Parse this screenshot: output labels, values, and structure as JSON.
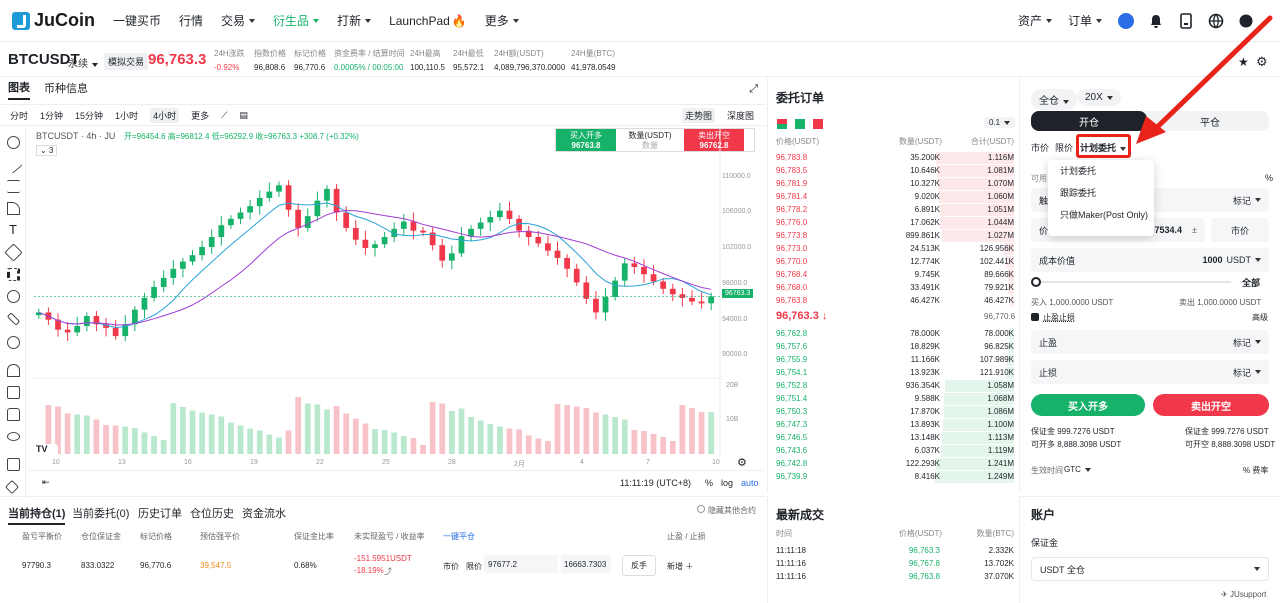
{
  "nav": {
    "logo": "JuCoin",
    "items": [
      "一键买币",
      "行情",
      "交易",
      "衍生品",
      "打新",
      "LaunchPad",
      "更多"
    ],
    "right": [
      "资产",
      "订单"
    ]
  },
  "ticker": {
    "symbol": "BTCUSDT",
    "perp": "永续",
    "tag": "模拟交易",
    "price": "96,763.3",
    "stats": [
      {
        "label": "24H涨跌",
        "value": "-0.92%",
        "color": "#f0384a"
      },
      {
        "label": "指数价格",
        "value": "96,808.6"
      },
      {
        "label": "标记价格",
        "value": "96,770.6"
      },
      {
        "label": "资金费率 / 结算时间",
        "value": "0.0005% / 00:05:00",
        "color": "#17b26a"
      },
      {
        "label": "24H最高",
        "value": "100,110.5"
      },
      {
        "label": "24H最低",
        "value": "95,572.1"
      },
      {
        "label": "24H额(USDT)",
        "value": "4,089,796,370.0000"
      },
      {
        "label": "24H量(BTC)",
        "value": "41,978.0549"
      }
    ]
  },
  "chartpanel": {
    "tabs": [
      "图表",
      "币种信息"
    ],
    "timeframes": [
      "分时",
      "1分钟",
      "15分钟",
      "1小时",
      "4小时",
      "更多"
    ],
    "views": [
      "走势图",
      "深度图"
    ],
    "legend": "BTCUSDT · 4h · JU",
    "ohlc": "开=96454.6 高=96812.4 低=96292.9 收=96763.3 +308.7 (+0.32%)",
    "indicator_count": "3",
    "buy_open_label": "买入开多",
    "buy_open_price": "96763.8",
    "qty_label": "数量(USDT)",
    "qty_placeholder": "数量",
    "sell_open_label": "卖出开空",
    "sell_open_price": "96762.8",
    "y_ticks": [
      "110000.0",
      "106000.0",
      "102000.0",
      "98000.0",
      "94000.0",
      "90000.0"
    ],
    "last_tag": "96763.3",
    "vol_ticks": [
      "20B",
      "10B"
    ],
    "x_ticks": [
      "10",
      "13",
      "16",
      "19",
      "22",
      "25",
      "28",
      "2月",
      "4",
      "7",
      "10"
    ],
    "time": "11:11:19 (UTC+8)",
    "opts": [
      "%",
      "log",
      "auto"
    ]
  },
  "chart_data": {
    "type": "candlestick",
    "title": "BTCUSDT · 4h · JU",
    "ylim": [
      88000,
      112000
    ],
    "closes": [
      95000,
      94200,
      93100,
      92800,
      93500,
      94600,
      93700,
      93300,
      92400,
      93700,
      95300,
      96600,
      97800,
      98800,
      99800,
      100600,
      101300,
      102200,
      103300,
      104600,
      105300,
      106000,
      106700,
      107600,
      108300,
      109000,
      106300,
      104300,
      105600,
      107300,
      108600,
      106000,
      104300,
      103000,
      102100,
      102500,
      103300,
      104200,
      105000,
      104000,
      103800,
      102400,
      100700,
      101500,
      103400,
      104200,
      104900,
      105500,
      106200,
      105300,
      104000,
      103300,
      102600,
      101800,
      101000,
      99800,
      98300,
      96500,
      95000,
      96700,
      98500,
      100400,
      100000,
      99200,
      98400,
      97600,
      97000,
      96600,
      96200,
      96000,
      96763.3
    ]
  },
  "orderbook": {
    "title": "委托订单",
    "precision": "0.1",
    "headers": [
      "价格(USDT)",
      "数量(USDT)",
      "合计(USDT)"
    ],
    "asks": [
      [
        "96,783.8",
        "35.200K",
        "1.116M",
        0.98
      ],
      [
        "96,783.5",
        "10.646K",
        "1.081M",
        0.96
      ],
      [
        "96,781.9",
        "10.327K",
        "1.070M",
        0.95
      ],
      [
        "96,781.4",
        "9.020K",
        "1.060M",
        0.94
      ],
      [
        "96,778.2",
        "6.891K",
        "1.051M",
        0.93
      ],
      [
        "96,776.0",
        "17.062K",
        "1.044M",
        0.92
      ],
      [
        "96,773.8",
        "899.861K",
        "1.027M",
        0.9
      ],
      [
        "96,773.0",
        "24.513K",
        "126.956K",
        0.12
      ],
      [
        "96,770.0",
        "12.774K",
        "102.441K",
        0.1
      ],
      [
        "96,768.4",
        "9.745K",
        "89.666K",
        0.08
      ],
      [
        "96,768.0",
        "33.491K",
        "79.921K",
        0.07
      ],
      [
        "96,763.8",
        "46.427K",
        "46.427K",
        0.04
      ]
    ],
    "mid": "96,763.3 ↓",
    "mark": "96,770.6",
    "bids": [
      [
        "96,762.8",
        "78.000K",
        "78.000K",
        0.06
      ],
      [
        "96,757.6",
        "18.829K",
        "96.825K",
        0.08
      ],
      [
        "96,755.9",
        "11.166K",
        "107.989K",
        0.09
      ],
      [
        "96,754.1",
        "13.923K",
        "121.910K",
        0.1
      ],
      [
        "96,752.8",
        "936.354K",
        "1.058M",
        0.86
      ],
      [
        "96,751.4",
        "9.588K",
        "1.068M",
        0.87
      ],
      [
        "96,750.3",
        "17.870K",
        "1.086M",
        0.88
      ],
      [
        "96,747.3",
        "13.893K",
        "1.100M",
        0.89
      ],
      [
        "96,746.5",
        "13.148K",
        "1.113M",
        0.9
      ],
      [
        "96,743.6",
        "6.037K",
        "1.119M",
        0.91
      ],
      [
        "96,742.8",
        "122.293K",
        "1.241M",
        0.98
      ],
      [
        "96,739.9",
        "8.416K",
        "1.249M",
        0.99
      ]
    ]
  },
  "trades": {
    "title": "最新成交",
    "headers": [
      "时间",
      "价格(USDT)",
      "数量(BTC)"
    ],
    "rows": [
      [
        "11:11:18",
        "96,763.3",
        "2.332K"
      ],
      [
        "11:11:16",
        "96,767.8",
        "13.702K"
      ],
      [
        "11:11:16",
        "96,763.8",
        "37.070K"
      ]
    ]
  },
  "order": {
    "margin_mode": "全仓",
    "leverage": "20X",
    "open": "开仓",
    "close": "平仓",
    "types": [
      "市价",
      "限价",
      "计划委托"
    ],
    "dropdown": [
      "计划委托",
      "跟踪委托",
      "只做Maker(Post Only)"
    ],
    "avail": "可用",
    "mark_label": "标记",
    "price_label": "价格",
    "price_value": "97534.4",
    "market_btn": "市价",
    "trigger_label": "触发",
    "cost_label": "成本价值",
    "cost_value": "1000",
    "cost_unit": "USDT",
    "slider_all": "全部",
    "buy_info": "买入 1,000.0000 USDT",
    "sell_info": "卖出 1,000.0000 USDT",
    "tpsl": "止盈止损",
    "advanced": "高级",
    "tp": "止盈",
    "sl": "止损",
    "tp_unit": "标记",
    "sl_unit": "标记",
    "buy_btn": "买入开多",
    "sell_btn": "卖出开空",
    "margin_l": "保证金 999.7276 USDT",
    "margin_r": "保证金 999.7276 USDT",
    "openable_l": "可开多 8,888.3098 USDT",
    "openable_r": "可开空 8,888.3098 USDT",
    "tif_label": "生效时间",
    "tif": "GTC",
    "fee": "费率"
  },
  "positions": {
    "tabs": [
      "当前持仓(1)",
      "当前委托(0)",
      "历史订单",
      "仓位历史",
      "资金流水"
    ],
    "hide": "隐藏其他合约",
    "headers": [
      "盈亏平衡价",
      "仓位保证金",
      "标记价格",
      "预估强平价",
      "保证金比率",
      "未实现盈亏 / 收益率",
      "一键平仓",
      "止盈 / 止损"
    ],
    "row": {
      "breakeven": "97790.3",
      "margin": "833.0322",
      "mark": "96,770.6",
      "liq": "39,547.5",
      "ratio": "0.68%",
      "pnl": "-151.5951USDT",
      "roe": "-18.19%",
      "market": "市价",
      "limit": "限价",
      "limit_price": "97677.2",
      "qty": "16663.7303",
      "reverse": "反手",
      "add": "新增"
    }
  },
  "account": {
    "title": "账户",
    "margin": "保证金",
    "select": "USDT 全仓",
    "support": "JUsupport"
  },
  "colors": {
    "green": "#17b26a",
    "red": "#f0384a",
    "annotation": "#e8231a"
  }
}
